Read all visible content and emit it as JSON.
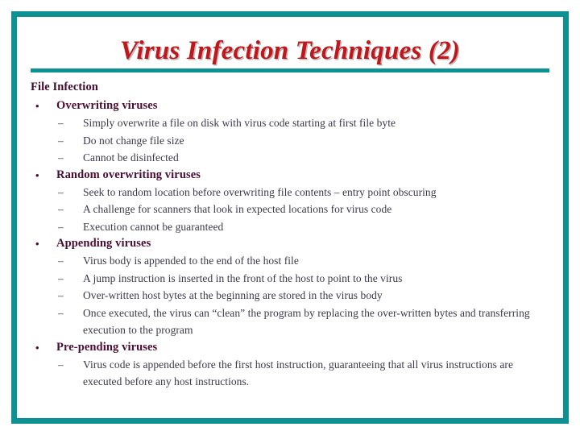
{
  "slide": {
    "title": "Virus Infection Techniques (2)",
    "theme": {
      "frame_color": "#0d9193",
      "rule_color": "#0d9193",
      "title_color": "#c0171c",
      "heading_color": "#3f0a2e",
      "bullet1_color": "#4a0d33",
      "bullet2_color": "#39394c",
      "background": "#ffffff"
    },
    "markers": {
      "level1": "•",
      "level2": "–"
    },
    "body": {
      "heading": "File Infection",
      "groups": [
        {
          "label": "Overwriting viruses",
          "items": [
            "Simply overwrite a file on disk with virus code starting at first file byte",
            "Do not change file size",
            "Cannot be disinfected"
          ]
        },
        {
          "label": "Random overwriting viruses",
          "items": [
            "Seek to random location before overwriting file contents – entry point obscuring",
            "A challenge for scanners that look in expected locations for virus code",
            "Execution cannot be guaranteed"
          ]
        },
        {
          "label": "Appending viruses",
          "items": [
            "Virus body is appended to the end of the host file",
            "A jump instruction is inserted in the front of the host to point to the virus",
            "Over-written host bytes at the beginning are stored in the virus body",
            "Once executed, the virus can “clean” the program by replacing the over-written bytes and transferring execution to the program"
          ]
        },
        {
          "label": "Pre-pending viruses",
          "items": [
            "Virus code is appended before the first host instruction, guaranteeing that all virus instructions are executed before any host instructions."
          ]
        }
      ]
    }
  }
}
